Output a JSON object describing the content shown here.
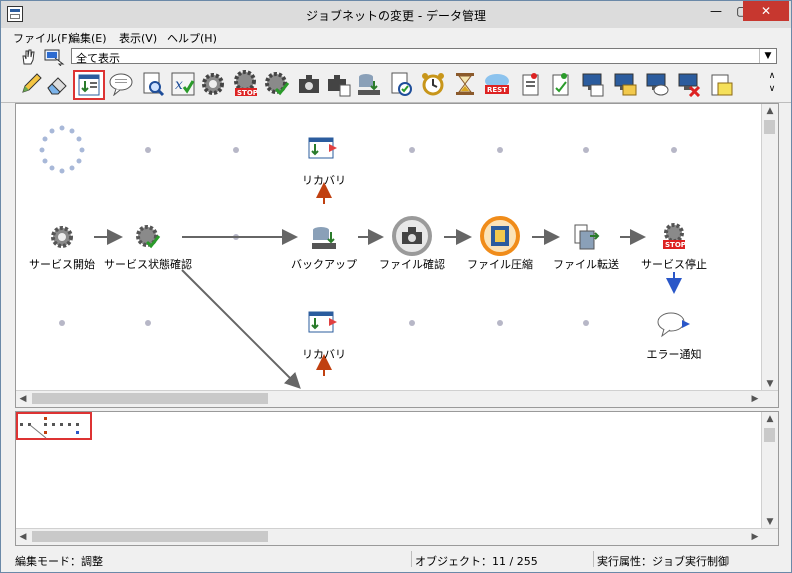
{
  "window": {
    "title": "ジョブネットの変更 - データ管理",
    "min": "—",
    "max": "▢",
    "close": "✕"
  },
  "menu": [
    {
      "label": "ファイル(F)"
    },
    {
      "label": "編集(E)"
    },
    {
      "label": "表示(V)"
    },
    {
      "label": "ヘルプ(H)"
    }
  ],
  "view_combo": {
    "value": "全て表示"
  },
  "toolbar_icons": [
    "hand-icon",
    "monitor-arrow-icon",
    "pencil-icon",
    "eraser-icon",
    "job-window-icon",
    "speech-bubble-icon",
    "search-doc-icon",
    "variable-check-icon",
    "gear-icon",
    "gear-stop-icon",
    "gear-check-icon",
    "camera-icon",
    "camera-doc-icon",
    "db-transfer-icon",
    "doc-check-icon",
    "alarm-clock-icon",
    "hourglass-icon",
    "rest-cloud-icon",
    "doc-pin-icon",
    "doc-pin2-icon",
    "pc-doc-icon",
    "pc-folder-icon",
    "pc-chat-icon",
    "pc-x-icon",
    "doc-star-icon"
  ],
  "nodes": [
    {
      "label": "サービス開始"
    },
    {
      "label": "サービス状態確認"
    },
    {
      "label": "バックアップ"
    },
    {
      "label": "ファイル確認"
    },
    {
      "label": "ファイル圧縮"
    },
    {
      "label": "ファイル転送"
    },
    {
      "label": "サービス停止"
    },
    {
      "label": "リカバリ"
    },
    {
      "label": "リカバリ"
    },
    {
      "label": "エラー通知"
    }
  ],
  "status": {
    "mode": "編集モード：調整",
    "objects": "オブジェクト：11 / 255",
    "exec_attr": "実行属性：ジョブ実行制御"
  },
  "colors": {
    "accent_red": "#d33333",
    "arrow_gray": "#666666",
    "arrow_red": "#c04010",
    "arrow_blue": "#2a57c8"
  }
}
